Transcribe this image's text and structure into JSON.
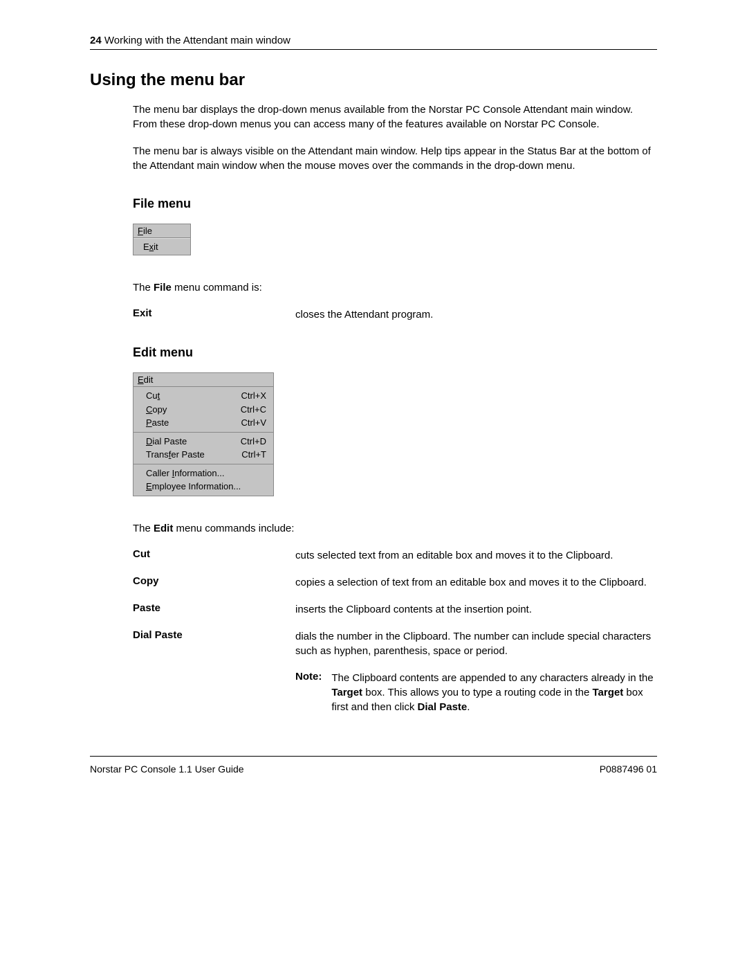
{
  "header": {
    "page_num": "24",
    "chapter": "Working with the Attendant main window"
  },
  "section_title": "Using the menu bar",
  "intro_para1": "The menu bar displays the drop-down menus available from the Norstar PC Console Attendant main window. From these drop-down menus you can access many of the features available on Norstar PC Console.",
  "intro_para2": "The menu bar is always visible on the Attendant main window. Help tips appear in the Status Bar at the bottom of the Attendant main window when the mouse moves over the commands in the drop-down menu.",
  "file_menu": {
    "heading": "File menu",
    "menu_title_prefix": "F",
    "menu_title_rest": "ile",
    "exit_prefix": "E",
    "exit_mid": "x",
    "exit_rest": "it",
    "intro_prefix": "The ",
    "intro_bold": "File",
    "intro_suffix": " menu command is:",
    "cmd_label": "Exit",
    "cmd_desc": "closes the Attendant program."
  },
  "edit_menu": {
    "heading": "Edit menu",
    "menu_title_prefix": "E",
    "menu_title_rest": "dit",
    "items": [
      {
        "label_pre": "Cu",
        "label_ul": "t",
        "label_post": "",
        "shortcut": "Ctrl+X"
      },
      {
        "label_pre": "",
        "label_ul": "C",
        "label_post": "opy",
        "shortcut": "Ctrl+C"
      },
      {
        "label_pre": "",
        "label_ul": "P",
        "label_post": "aste",
        "shortcut": "Ctrl+V"
      }
    ],
    "items2": [
      {
        "label_pre": "",
        "label_ul": "D",
        "label_post": "ial Paste",
        "shortcut": "Ctrl+D"
      },
      {
        "label_pre": "Trans",
        "label_ul": "f",
        "label_post": "er Paste",
        "shortcut": "Ctrl+T"
      }
    ],
    "items3": [
      {
        "label_pre": "Caller ",
        "label_ul": "I",
        "label_post": "nformation...",
        "shortcut": ""
      },
      {
        "label_pre": "",
        "label_ul": "E",
        "label_post": "mployee Information...",
        "shortcut": ""
      }
    ],
    "intro_prefix": "The ",
    "intro_bold": "Edit",
    "intro_suffix": " menu commands include:",
    "commands": [
      {
        "label": "Cut",
        "desc": "cuts selected text from an editable box and moves it to the Clipboard."
      },
      {
        "label": "Copy",
        "desc": "copies a selection of text from an editable box and moves it to the Clipboard."
      },
      {
        "label": "Paste",
        "desc": "inserts the Clipboard contents at the insertion point."
      },
      {
        "label": "Dial Paste",
        "desc": "dials the number in the Clipboard. The number can include special characters such as hyphen, parenthesis, space or period."
      }
    ],
    "note_label": "Note:",
    "note_pre": "The Clipboard contents are appended to any characters already in the ",
    "note_bold1": "Target",
    "note_mid1": " box. This allows you to type a routing code in the ",
    "note_bold2": "Target",
    "note_mid2": " box first and then click ",
    "note_bold3": "Dial Paste",
    "note_end": "."
  },
  "footer": {
    "left": "Norstar PC Console 1.1 User Guide",
    "right": "P0887496 01"
  }
}
